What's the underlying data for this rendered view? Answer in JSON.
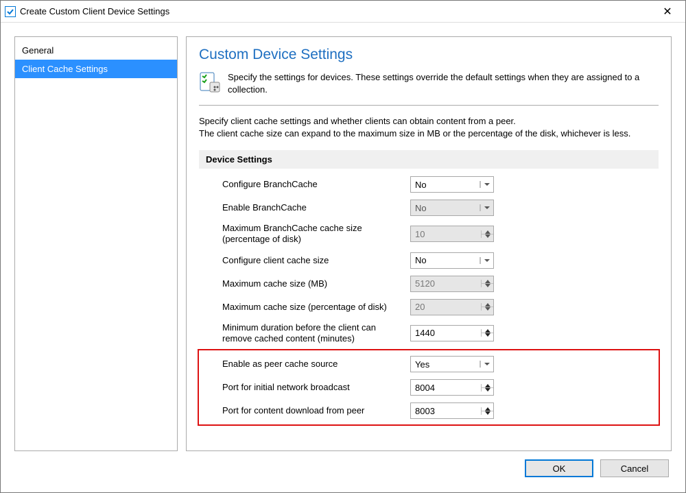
{
  "window": {
    "title": "Create Custom Client Device Settings"
  },
  "nav": {
    "items": [
      {
        "label": "General",
        "selected": false
      },
      {
        "label": "Client Cache Settings",
        "selected": true
      }
    ]
  },
  "content": {
    "heading": "Custom Device Settings",
    "intro": "Specify the settings for devices. These settings override the default settings when they are assigned to a collection.",
    "desc_line1": "Specify client cache settings and whether clients can obtain content from a peer.",
    "desc_line2": "The client cache size can expand to the maximum size in MB or the percentage of the disk, whichever is less.",
    "section_title": "Device Settings",
    "settings": [
      {
        "label": "Configure BranchCache",
        "type": "dropdown",
        "value": "No",
        "enabled": true
      },
      {
        "label": "Enable BranchCache",
        "type": "dropdown",
        "value": "No",
        "enabled": false
      },
      {
        "label": "Maximum BranchCache cache size (percentage of disk)",
        "type": "spinner",
        "value": "10",
        "enabled": false
      },
      {
        "label": "Configure client cache size",
        "type": "dropdown",
        "value": "No",
        "enabled": true
      },
      {
        "label": "Maximum cache size (MB)",
        "type": "spinner",
        "value": "5120",
        "enabled": false
      },
      {
        "label": "Maximum cache size (percentage of disk)",
        "type": "spinner",
        "value": "20",
        "enabled": false
      },
      {
        "label": "Minimum duration before the client can remove cached content (minutes)",
        "type": "spinner",
        "value": "1440",
        "enabled": true
      },
      {
        "label": "Enable as peer cache source",
        "type": "dropdown",
        "value": "Yes",
        "enabled": true
      },
      {
        "label": "Port for initial network broadcast",
        "type": "spinner",
        "value": "8004",
        "enabled": true
      },
      {
        "label": "Port for content download from peer",
        "type": "spinner",
        "value": "8003",
        "enabled": true
      }
    ]
  },
  "buttons": {
    "ok": "OK",
    "cancel": "Cancel"
  }
}
